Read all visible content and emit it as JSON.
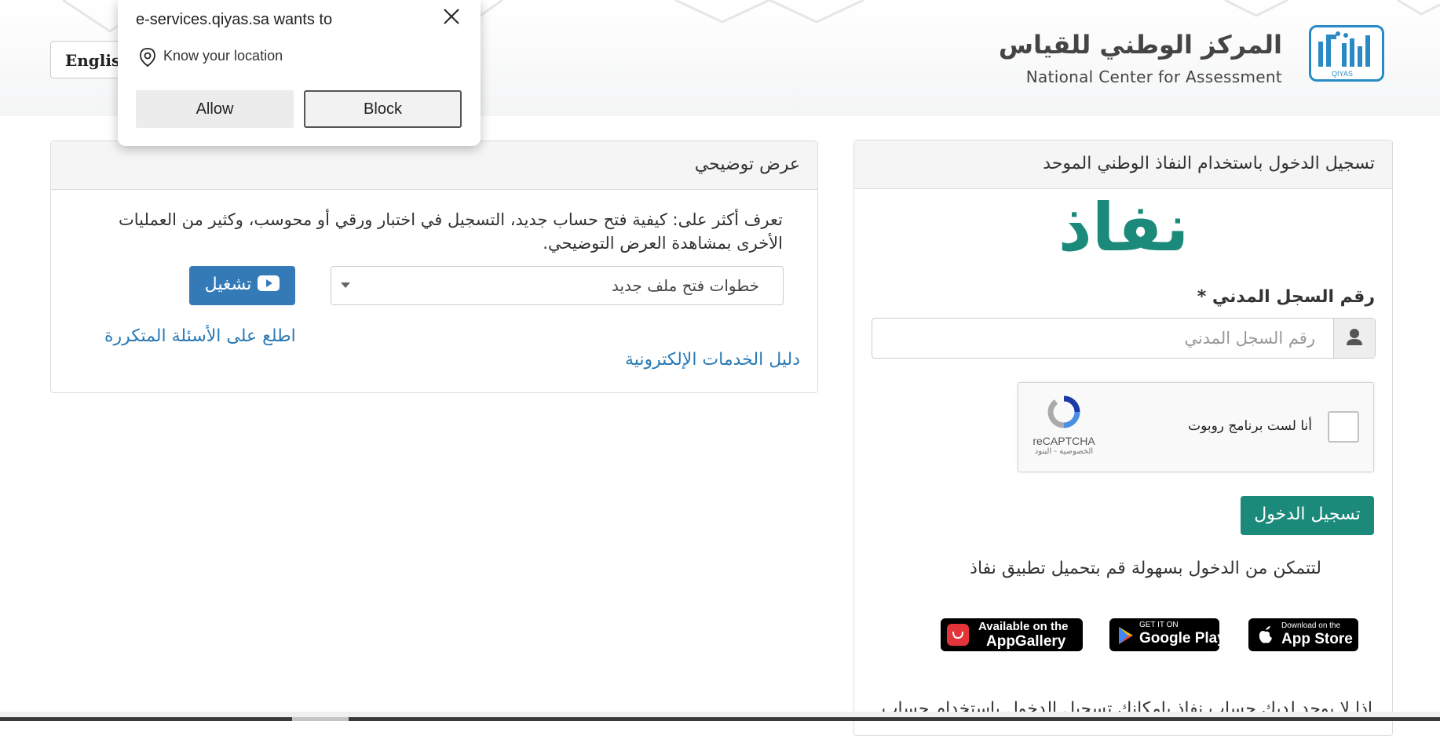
{
  "header": {
    "language_button": "English",
    "logo_arabic": "المركز الوطني للقياس",
    "logo_english": "National Center for Assessment",
    "logo_badge": "QIYAS"
  },
  "permission_popup": {
    "title": "e-services.qiyas.sa wants to",
    "permission": "Know your location",
    "allow_label": "Allow",
    "block_label": "Block"
  },
  "demo_panel": {
    "title": "عرض توضيحي",
    "description": "تعرف أكثر على: كيفية فتح حساب جديد، التسجيل في اختبار ورقي أو محوسب، وكثير من العمليات الأخرى بمشاهدة العرض التوضيحي.",
    "selected_video": "خطوات فتح ملف جديد",
    "play_label": "تشغيل",
    "faq_link": "اطلع على الأسئلة المتكررة",
    "guide_link": "دليل الخدمات الإلكترونية"
  },
  "login_panel": {
    "title": "تسجيل الدخول باستخدام النفاذ الوطني الموحد",
    "nafath_logo_text": "نفاذ",
    "id_label": "رقم السجل المدني *",
    "id_placeholder": "رقم السجل المدني",
    "captcha_label": "أنا لست برنامج روبوت",
    "captcha_brand": "reCAPTCHA",
    "captcha_links": "الخصوصية - البنود",
    "login_button": "تسجيل الدخول",
    "download_text": "لتتمكن من الدخول بسهولة قم بتحميل تطبيق نفاذ",
    "stores": {
      "appstore_small": "Download on the",
      "appstore_big": "App Store",
      "googleplay_small": "GET IT ON",
      "googleplay_big": "Google Play",
      "appgallery_small": "Available on the",
      "appgallery_big": "AppGallery"
    },
    "bottom_note": "إذا لا يوجد لديك حساب نفاذ بإمكانك تسجيل الدخول باستخدام حساب"
  },
  "colors": {
    "nafath_green": "#1b8a7a",
    "primary_blue": "#337ab7",
    "link_blue": "#2a7ab5",
    "qiyas_blue": "#2a8ac6"
  }
}
